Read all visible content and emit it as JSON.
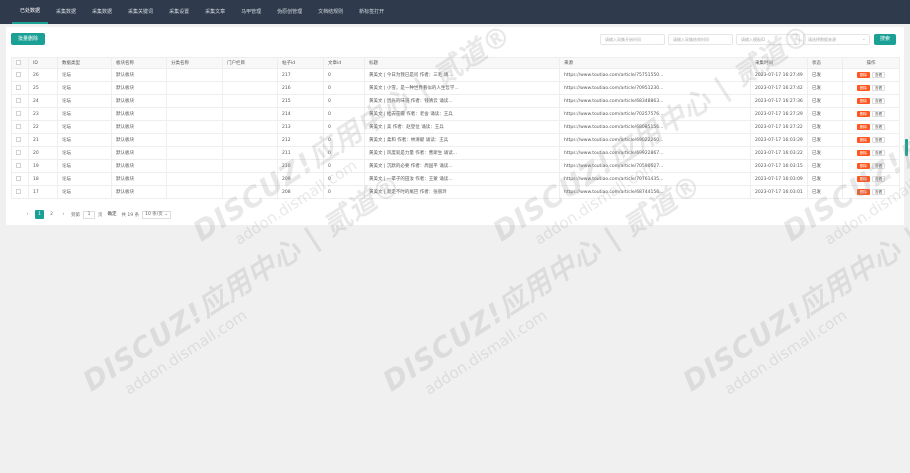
{
  "nav": {
    "items": [
      {
        "label": "已处数据",
        "active": true
      },
      {
        "label": "采集数据",
        "active": false
      },
      {
        "label": "采集数据",
        "active": false
      },
      {
        "label": "采集关键词",
        "active": false
      },
      {
        "label": "采集设置",
        "active": false
      },
      {
        "label": "采集文章",
        "active": false
      },
      {
        "label": "马甲管理",
        "active": false
      },
      {
        "label": "伪原创管理",
        "active": false
      },
      {
        "label": "文档结规则",
        "active": false
      },
      {
        "label": "新标签打开",
        "active": false
      }
    ]
  },
  "toolbar": {
    "batch_delete_label": "批量删除",
    "search_label": "搜索",
    "filters": [
      {
        "placeholder": "请输入采集开始时间"
      },
      {
        "placeholder": "请输入采集结束时间"
      },
      {
        "placeholder": "请输入模板ID"
      },
      {
        "placeholder": "请选择数据来源"
      }
    ]
  },
  "table": {
    "columns": [
      "",
      "ID",
      "数据类型",
      "板块名称",
      "分类名称",
      "门户栏目",
      "帖子id",
      "文章id",
      "标题",
      "来源",
      "采集时间",
      "状态",
      "操作"
    ],
    "rows": [
      {
        "id": "26",
        "type": "论坛",
        "board": "默认板块",
        "cat": "",
        "portal": "",
        "tid": "217",
        "aid": "0",
        "title": "黄美文 | 今日为我已是问 作者：三毛 请...",
        "source": "https://www.toutiao.com/article/75751550...",
        "time": "2023-07-17 16:27:49",
        "status": "已发"
      },
      {
        "id": "25",
        "type": "论坛",
        "board": "默认板块",
        "cat": "",
        "portal": "",
        "tid": "216",
        "aid": "0",
        "title": "黄美文 | 小雪，是一种世界看似的人生哲学...",
        "source": "https://www.toutiao.com/article/70951230...",
        "time": "2023-07-17 16:27:42",
        "status": "已发"
      },
      {
        "id": "24",
        "type": "论坛",
        "board": "默认板块",
        "cat": "",
        "portal": "",
        "tid": "215",
        "aid": "0",
        "title": "黄美文 | 因光的味道 作者：钱清云 诵读...",
        "source": "https://www.toutiao.com/article/68348863...",
        "time": "2023-07-17 16:27:36",
        "status": "已发"
      },
      {
        "id": "23",
        "type": "论坛",
        "board": "默认板块",
        "cat": "",
        "portal": "",
        "tid": "214",
        "aid": "0",
        "title": "黄美文 | 拙去花瓣 作者：老舍 诵读：王兵",
        "source": "https://www.toutiao.com/article/70257576...",
        "time": "2023-07-17 16:27:29",
        "status": "已发"
      },
      {
        "id": "22",
        "type": "论坛",
        "board": "默认板块",
        "cat": "",
        "portal": "",
        "tid": "213",
        "aid": "0",
        "title": "黄美文 | 美 作者：赵登位 诵读：王兵",
        "source": "https://www.toutiao.com/article/68085156...",
        "time": "2023-07-17 16:27:22",
        "status": "已发"
      },
      {
        "id": "21",
        "type": "论坛",
        "board": "默认板块",
        "cat": "",
        "portal": "",
        "tid": "212",
        "aid": "0",
        "title": "黄美文 | 柔和 作者：林清献 诵读：王兵",
        "source": "https://www.toutiao.com/article/69022260...",
        "time": "2023-07-17 16:03:29",
        "status": "已发"
      },
      {
        "id": "20",
        "type": "论坛",
        "board": "默认板块",
        "cat": "",
        "portal": "",
        "tid": "211",
        "aid": "0",
        "title": "黄美文 | 风度就是力量 作者：曹斯生 诵读...",
        "source": "https://www.toutiao.com/article/69922867...",
        "time": "2023-07-17 16:03:22",
        "status": "已发"
      },
      {
        "id": "19",
        "type": "论坛",
        "board": "默认板块",
        "cat": "",
        "portal": "",
        "tid": "210",
        "aid": "0",
        "title": "黄美文 | 沉默的必要 作者：周国平 诵读...",
        "source": "https://www.toutiao.com/article/70590627...",
        "time": "2023-07-17 16:03:15",
        "status": "已发"
      },
      {
        "id": "18",
        "type": "论坛",
        "board": "默认板块",
        "cat": "",
        "portal": "",
        "tid": "209",
        "aid": "0",
        "title": "黄美文 | 一辈子的田汝 作者：王蒙 诵读...",
        "source": "https://www.toutiao.com/article/70761435...",
        "time": "2023-07-17 16:03:09",
        "status": "已发"
      },
      {
        "id": "17",
        "type": "论坛",
        "board": "默认板块",
        "cat": "",
        "portal": "",
        "tid": "208",
        "aid": "0",
        "title": "黄美文 | 就走不时的尾巴 作者：张丽玲",
        "source": "https://www.toutiao.com/article/68744156...",
        "time": "2023-07-17 16:03:01",
        "status": "已发"
      }
    ],
    "delete_label": "删除",
    "view_label": "查看"
  },
  "pagination": {
    "prev": "‹",
    "page1": "1",
    "page2": "2",
    "next": "›",
    "goto_label": "到第",
    "goto_value": "1",
    "page_unit": "页",
    "confirm_label": "确定",
    "total": "共 19 条",
    "per_page": "10 条/页"
  },
  "watermark": {
    "main": "DISCUZ!应用中心 | 贰道®",
    "sub": "addon.dismall.com"
  }
}
